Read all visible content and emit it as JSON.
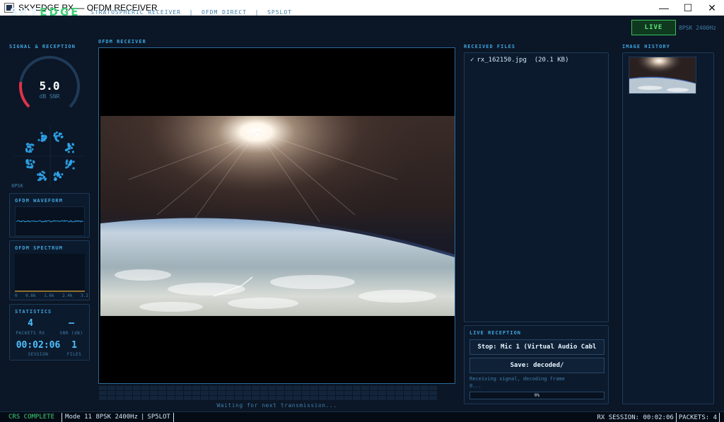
{
  "window": {
    "title": "SKYEDGE RX — OFDM RECEIVER",
    "minimize": "—",
    "maximize": "☐",
    "close": "✕"
  },
  "header": {
    "logo_main": "SKY",
    "logo_accent": "EDGE",
    "subtitle": "STRATOSPHERIC RECEIVER  |  OFDM DIRECT  |  SP5LOT",
    "live_label": "LIVE",
    "mode_label": "8PSK 2400Hz"
  },
  "signal": {
    "section_title": "SIGNAL & RECEPTION",
    "snr_value": "5.0",
    "snr_unit": "dB SNR",
    "constellation_label": "8PSK"
  },
  "waveform": {
    "title": "OFDM WAVEFORM"
  },
  "spectrum": {
    "title": "OFDM SPECTRUM",
    "ticks": [
      "0",
      "0.8k",
      "1.6k",
      "2.4k",
      "3.2"
    ]
  },
  "statistics": {
    "title": "STATISTICS",
    "packets_value": "4",
    "packets_label": "PACKETS RX",
    "snr_value": "—",
    "snr_label": "SNR (dB)",
    "session_value": "00:02:06",
    "session_label": "SESSION",
    "files_value": "1",
    "files_label": "FILES"
  },
  "receiver": {
    "title": "OFDM RECEIVER",
    "waiting_text": "Waiting for next transmission..."
  },
  "files": {
    "title": "RECEIVED FILES",
    "items": [
      {
        "check": "✓",
        "name": "rx_162150.jpg",
        "size": "(20.1 KB)"
      }
    ]
  },
  "live_reception": {
    "title": "LIVE RECEPTION",
    "stop_button": "Stop: Mic 1 (Virtual Audio Cabl",
    "save_button": "Save: decoded/",
    "status_line1": "Receiving signal, decoding frame",
    "status_line2": "0...",
    "progress_text": "0%",
    "progress_fraction": 0.0
  },
  "history": {
    "title": "IMAGE HISTORY"
  },
  "statusbar": {
    "complete": "CRS COMPLETE",
    "mode": "Mode 11 8PSK 2400Hz",
    "callsign": "SP5LOT",
    "session": "RX SESSION: 00:02:06",
    "packets": "PACKETS: 4"
  },
  "colors": {
    "accent": "#3fa6e0",
    "live_green": "#3fd07a",
    "gauge_red": "#e0314a",
    "background": "#0b1626"
  }
}
